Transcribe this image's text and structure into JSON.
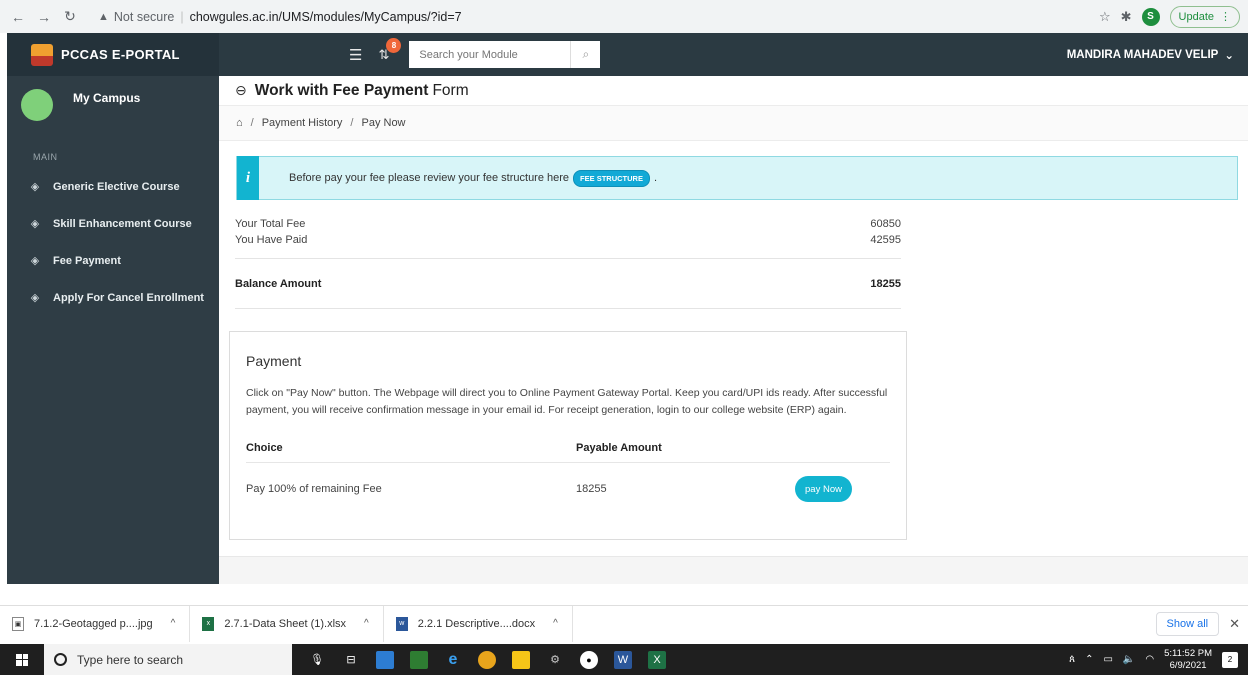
{
  "browser": {
    "security_label": "Not secure",
    "url": "chowgules.ac.in/UMS/modules/MyCampus/?id=7",
    "profile_initial": "S",
    "update_label": "Update"
  },
  "header": {
    "brand": "PCCAS E-PORTAL",
    "notification_count": "8",
    "search_placeholder": "Search your Module",
    "user_name": "MANDIRA MAHADEV VELIP"
  },
  "sidebar": {
    "campus_label": "My Campus",
    "section_label": "MAIN",
    "items": [
      {
        "label": "Generic Elective Course"
      },
      {
        "label": "Skill Enhancement Course"
      },
      {
        "label": "Fee Payment"
      },
      {
        "label": "Apply For Cancel Enrollment"
      }
    ]
  },
  "page": {
    "title_bold": "Work with Fee Payment",
    "title_light": "Form",
    "breadcrumb": [
      "Payment History",
      "Pay Now"
    ],
    "info_text": "Before pay your fee please review your fee structure here",
    "info_badge": "FEE STRUCTURE",
    "info_after_badge": ".",
    "total_fee_label": "Your Total Fee",
    "total_fee_value": "60850",
    "paid_label": "You Have Paid",
    "paid_value": "42595",
    "balance_label": "Balance Amount",
    "balance_value": "18255"
  },
  "payment": {
    "title": "Payment",
    "description": "Click on \"Pay Now\" button. The Webpage will direct you to Online Payment Gateway Portal. Keep you card/UPI ids ready. After successful payment, you will receive confirmation message in your email id. For receipt generation, login to our college website (ERP) again.",
    "columns": [
      "Choice",
      "Payable Amount"
    ],
    "rows": [
      {
        "choice": "Pay 100% of remaining Fee",
        "amount": "18255",
        "button": "pay Now"
      }
    ]
  },
  "downloads": {
    "items": [
      {
        "name": "7.1.2-Geotagged p....jpg",
        "type": "image"
      },
      {
        "name": "2.7.1-Data Sheet (1).xlsx",
        "type": "excel"
      },
      {
        "name": "2.2.1 Descriptive....docx",
        "type": "word"
      }
    ],
    "show_all_label": "Show all"
  },
  "taskbar": {
    "search_placeholder": "Type here to search",
    "time": "5:11:52 PM",
    "date": "6/9/2021",
    "notification_count": "2"
  },
  "colors": {
    "header_bg": "#2b3a42",
    "sidebar_bg": "#2f3d45",
    "accent": "#12b4d0",
    "info_bg": "#d8f5f8"
  }
}
